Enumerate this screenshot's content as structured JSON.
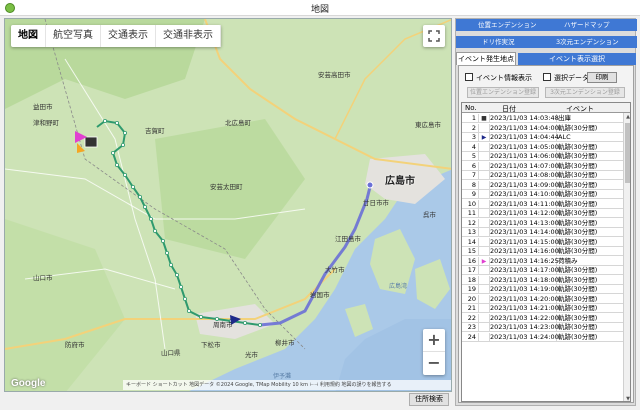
{
  "window": {
    "title": "地図"
  },
  "map": {
    "type_buttons": [
      "地図",
      "航空写真",
      "交通表示",
      "交通非表示"
    ],
    "zoom_in": "+",
    "zoom_out": "−",
    "google_logo": "Google",
    "attribution": "キーボード ショートカット   地図データ ©2024 Google, TMap Mobility   10 km ⊢⊣   利用規約   地図の誤りを報告する",
    "labels": {
      "hiroshima": "広島市",
      "hatsukaichi": "廿日市市",
      "kitahiroshima": "北広島町",
      "akitakata": "安芸高田市",
      "higashihiroshima": "東広島市",
      "iwakuni": "岩国市",
      "shunan": "周南市",
      "yamaguchi": "山口市",
      "kure": "呉市",
      "ootake": "大竹市",
      "kudamatsu": "下松市",
      "hikari": "光市",
      "yanai": "柳井市",
      "hofu": "防府市",
      "tsuwano": "津和野町",
      "masuda": "益田市",
      "etajima": "江田島市",
      "yamaguchi_pref": "山口県",
      "hiroshima_bay": "広島湾",
      "iyonada": "伊予灘",
      "yoshika": "吉賀町",
      "akiota": "安芸太田町"
    }
  },
  "address_search_label": "住所検索",
  "panel": {
    "top_tabs_row1": [
      "位置エンデンション",
      "ハザードマップ"
    ],
    "top_tabs_row2": [
      "ドリ作実況",
      "3次元エンデンション"
    ],
    "active_tab": "イベント発生地点",
    "other_tab": "イベント表示選択",
    "event_info_label": "イベント情報表示",
    "select_data_label": "選択データ",
    "print_label": "印刷",
    "disabled_btn1": "位置エンデンション登録",
    "disabled_btn2": "3次元エンデンション登録",
    "grid_headers": {
      "no": "No.",
      "date": "日付",
      "event": "イベント"
    },
    "rows": [
      {
        "no": "1",
        "marker": "■",
        "date": "2023/11/03 14:03:48",
        "event": "出庫"
      },
      {
        "no": "2",
        "marker": "",
        "date": "2023/11/03 14:04:00",
        "event": "軌跡(30分間)"
      },
      {
        "no": "3",
        "marker": "▶",
        "date": "2023/11/03 14:04:44",
        "event": "ALC"
      },
      {
        "no": "4",
        "marker": "",
        "date": "2023/11/03 14:05:00",
        "event": "軌跡(30分間)"
      },
      {
        "no": "5",
        "marker": "",
        "date": "2023/11/03 14:06:00",
        "event": "軌跡(30分間)"
      },
      {
        "no": "6",
        "marker": "",
        "date": "2023/11/03 14:07:00",
        "event": "軌跡(30分間)"
      },
      {
        "no": "7",
        "marker": "",
        "date": "2023/11/03 14:08:00",
        "event": "軌跡(30分間)"
      },
      {
        "no": "8",
        "marker": "",
        "date": "2023/11/03 14:09:00",
        "event": "軌跡(30分間)"
      },
      {
        "no": "9",
        "marker": "",
        "date": "2023/11/03 14:10:00",
        "event": "軌跡(30分間)"
      },
      {
        "no": "10",
        "marker": "",
        "date": "2023/11/03 14:11:00",
        "event": "軌跡(30分間)"
      },
      {
        "no": "11",
        "marker": "",
        "date": "2023/11/03 14:12:00",
        "event": "軌跡(30分間)"
      },
      {
        "no": "12",
        "marker": "",
        "date": "2023/11/03 14:13:00",
        "event": "軌跡(30分間)"
      },
      {
        "no": "13",
        "marker": "",
        "date": "2023/11/03 14:14:00",
        "event": "軌跡(30分間)"
      },
      {
        "no": "14",
        "marker": "",
        "date": "2023/11/03 14:15:00",
        "event": "軌跡(30分間)"
      },
      {
        "no": "15",
        "marker": "",
        "date": "2023/11/03 14:16:00",
        "event": "軌跡(30分間)"
      },
      {
        "no": "16",
        "marker": "▶",
        "date": "2023/11/03 14:16:25",
        "event": "荷積み"
      },
      {
        "no": "17",
        "marker": "",
        "date": "2023/11/03 14:17:00",
        "event": "軌跡(30分間)"
      },
      {
        "no": "18",
        "marker": "",
        "date": "2023/11/03 14:18:00",
        "event": "軌跡(30分間)"
      },
      {
        "no": "19",
        "marker": "",
        "date": "2023/11/03 14:19:00",
        "event": "軌跡(30分間)"
      },
      {
        "no": "20",
        "marker": "",
        "date": "2023/11/03 14:20:00",
        "event": "軌跡(30分間)"
      },
      {
        "no": "21",
        "marker": "",
        "date": "2023/11/03 14:21:00",
        "event": "軌跡(30分間)"
      },
      {
        "no": "22",
        "marker": "",
        "date": "2023/11/03 14:22:00",
        "event": "軌跡(30分間)"
      },
      {
        "no": "23",
        "marker": "",
        "date": "2023/11/03 14:23:00",
        "event": "軌跡(30分間)"
      },
      {
        "no": "24",
        "marker": "",
        "date": "2023/11/03 14:24:00",
        "event": "軌跡(30分間)"
      }
    ]
  },
  "colors": {
    "tab_blue": "#3f78d4",
    "track_green": "#2e9a6e",
    "route_blue": "#6a6fd6",
    "marker_pink": "#e040d0",
    "marker_navy": "#1e2a8a"
  }
}
